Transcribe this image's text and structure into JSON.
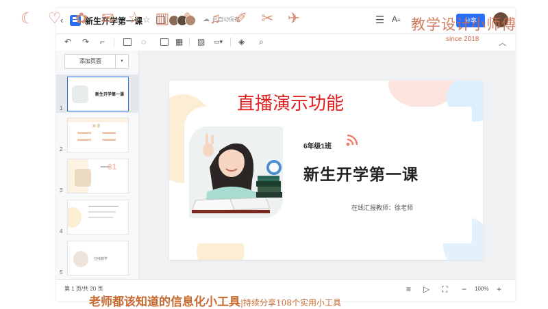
{
  "app": {
    "doc_title": "新生开学第一课",
    "save_status": "已自动保存",
    "share_label": "分享"
  },
  "toolbar": {
    "add_page_label": "添加页面"
  },
  "sidebar": {
    "thumbnails": [
      {
        "number": "1",
        "label": "新生开学第一课"
      },
      {
        "number": "2",
        "label": "目 录"
      },
      {
        "number": "3",
        "label": "01"
      },
      {
        "number": "4",
        "label": ""
      },
      {
        "number": "5",
        "label": "在线教学"
      }
    ]
  },
  "slide": {
    "class_label": "6年级1班",
    "title": "新生开学第一课",
    "teacher": "在线汇报教师：徐老师"
  },
  "statusbar": {
    "page_counter": "第 1 页/共 20 页",
    "zoom": "100%"
  },
  "overlays": {
    "watermark": "教学设计小师傅",
    "since": "since 2018",
    "live_demo": "直播演示功能",
    "bottom_caption_main": "老师都该知道的信息化小工具",
    "bottom_caption_sub": "|持续分享108个实用小工具"
  },
  "colors": {
    "accent": "#2a6ef5",
    "watermark": "#c96a4a",
    "live_demo": "#e02020"
  },
  "icons": [
    "back-icon",
    "doc-logo-icon",
    "star-icon",
    "folder-icon",
    "cloud-icon",
    "menu-icon",
    "font-icon",
    "undo-icon",
    "redo-icon",
    "format-painter-icon",
    "textbox-icon",
    "shape-icon",
    "image-icon",
    "table-icon",
    "pattern-icon",
    "more-icon",
    "fill-icon",
    "search-icon",
    "collapse-icon",
    "notes-icon",
    "play-icon",
    "fullscreen-icon",
    "zoom-out-icon",
    "zoom-in-icon",
    "wifi-icon"
  ]
}
